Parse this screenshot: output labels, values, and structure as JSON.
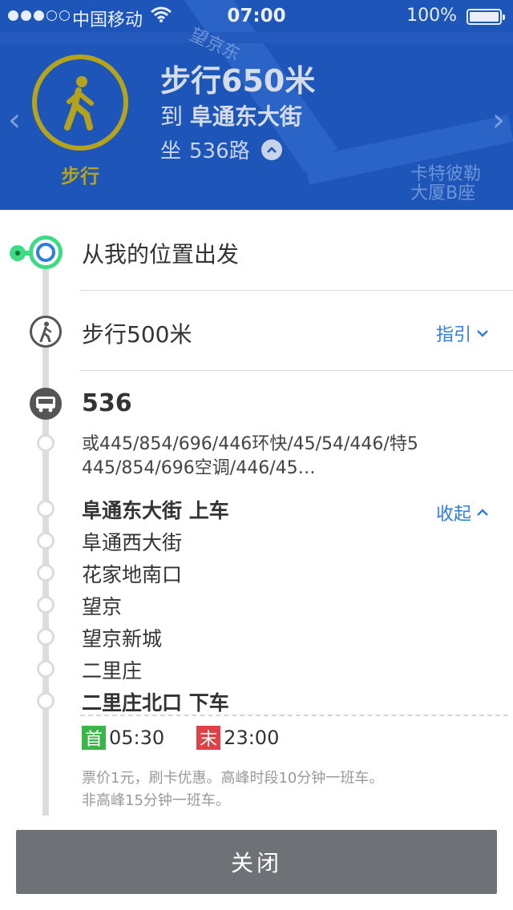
{
  "status_bar": {
    "carrier": "中国移动",
    "time": "07:00",
    "battery": "100%",
    "signal_bars": 3
  },
  "map": {
    "label_road": "望京东",
    "label_building": "卡特彼勒\n大厦B座"
  },
  "current_step": {
    "icon": "walking-person-icon",
    "caption": "步行",
    "title": "步行650米",
    "dest_prefix": "到",
    "dest_name": "阜通东大街",
    "line_prefix": "坐",
    "line_name": "536路"
  },
  "steps": {
    "origin_label": "从我的位置出发",
    "walk_label": "步行500米",
    "guide_label": "指引",
    "route_number": "536",
    "alt_lines": "或445/854/696/446环快/45/54/446/特5\n445/854/696空调/446/45…",
    "collapse_label": "收起",
    "stops": [
      {
        "name": "阜通东大街 上车",
        "strong": true
      },
      {
        "name": "阜通西大街",
        "strong": false
      },
      {
        "name": "花家地南口",
        "strong": false
      },
      {
        "name": "望京",
        "strong": false
      },
      {
        "name": "望京新城",
        "strong": false
      },
      {
        "name": "二里庄",
        "strong": false
      },
      {
        "name": "二里庄北口 下车",
        "strong": true
      }
    ],
    "first_tag": "首",
    "first_time": "05:30",
    "last_tag": "末",
    "last_time": "23:00",
    "fare_line1": "票价1元，刷卡优惠。高峰时段10分钟一班车。",
    "fare_line2": "非高峰15分钟一班车。"
  },
  "close_button": "关闭",
  "colors": {
    "header_bg": "#1d55b8",
    "walk_accent": "#b5a31c",
    "link_blue": "#2e7de0",
    "origin_green": "#3ddc84",
    "first_green": "#3ab54a",
    "last_red": "#e04048",
    "button_gray": "#6e7277"
  }
}
